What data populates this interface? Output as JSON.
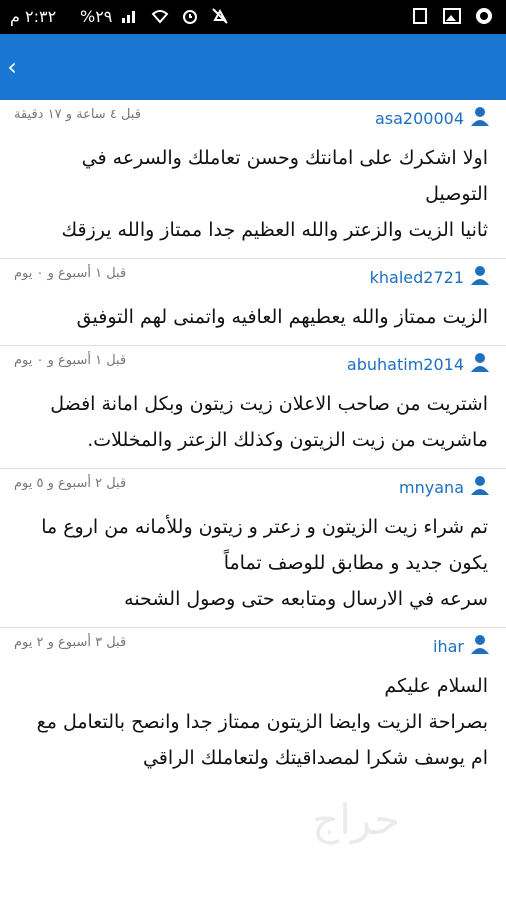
{
  "status_bar": {
    "time": "٢:٣٢ م",
    "battery": "%٢٩"
  },
  "app_bar": {
    "back_glyph": "‹"
  },
  "reviews": [
    {
      "user": "asa200004",
      "time_ago": "قبل ٤ ساعة و ١٧ دقيقة",
      "lines": [
        "اولا اشكرك على امانتك وحسن تعاملك والسرعه في",
        "التوصيل",
        "ثانيا الزيت والزعتر والله العظيم جدا ممتاز والله يرزقك"
      ]
    },
    {
      "user": "khaled2721",
      "time_ago": "قبل ١ أسبوع و ٠ يوم",
      "lines": [
        "الزيت ممتاز والله يعطيهم العافيه واتمنى لهم التوفيق"
      ]
    },
    {
      "user": "abuhatim2014",
      "time_ago": "قبل ١ أسبوع و ٠ يوم",
      "lines": [
        "اشتريت من صاحب الاعلان زيت زيتون وبكل امانة افضل",
        "ماشريت من زيت الزيتون وكذلك الزعتر والمخللات."
      ]
    },
    {
      "user": "mnyana",
      "time_ago": "قبل ٢ أسبوع و ٥ يوم",
      "lines": [
        "تم شراء زيت الزيتون و زعتر و زيتون وللأمانه من اروع ما",
        "يكون جديد و مطابق للوصف تماماً",
        "سرعه في الارسال ومتابعه حتى وصول الشحنه"
      ]
    },
    {
      "user": "ihar",
      "time_ago": "قبل ٣ أسبوع و ٢ يوم",
      "lines": [
        "السلام عليكم",
        "بصراحة الزيت وايضا الزيتون ممتاز جدا وانصح بالتعامل مع",
        "ام يوسف شكرا لمصداقيتك ولتعاملك الراقي"
      ]
    }
  ],
  "watermark": "حراج"
}
